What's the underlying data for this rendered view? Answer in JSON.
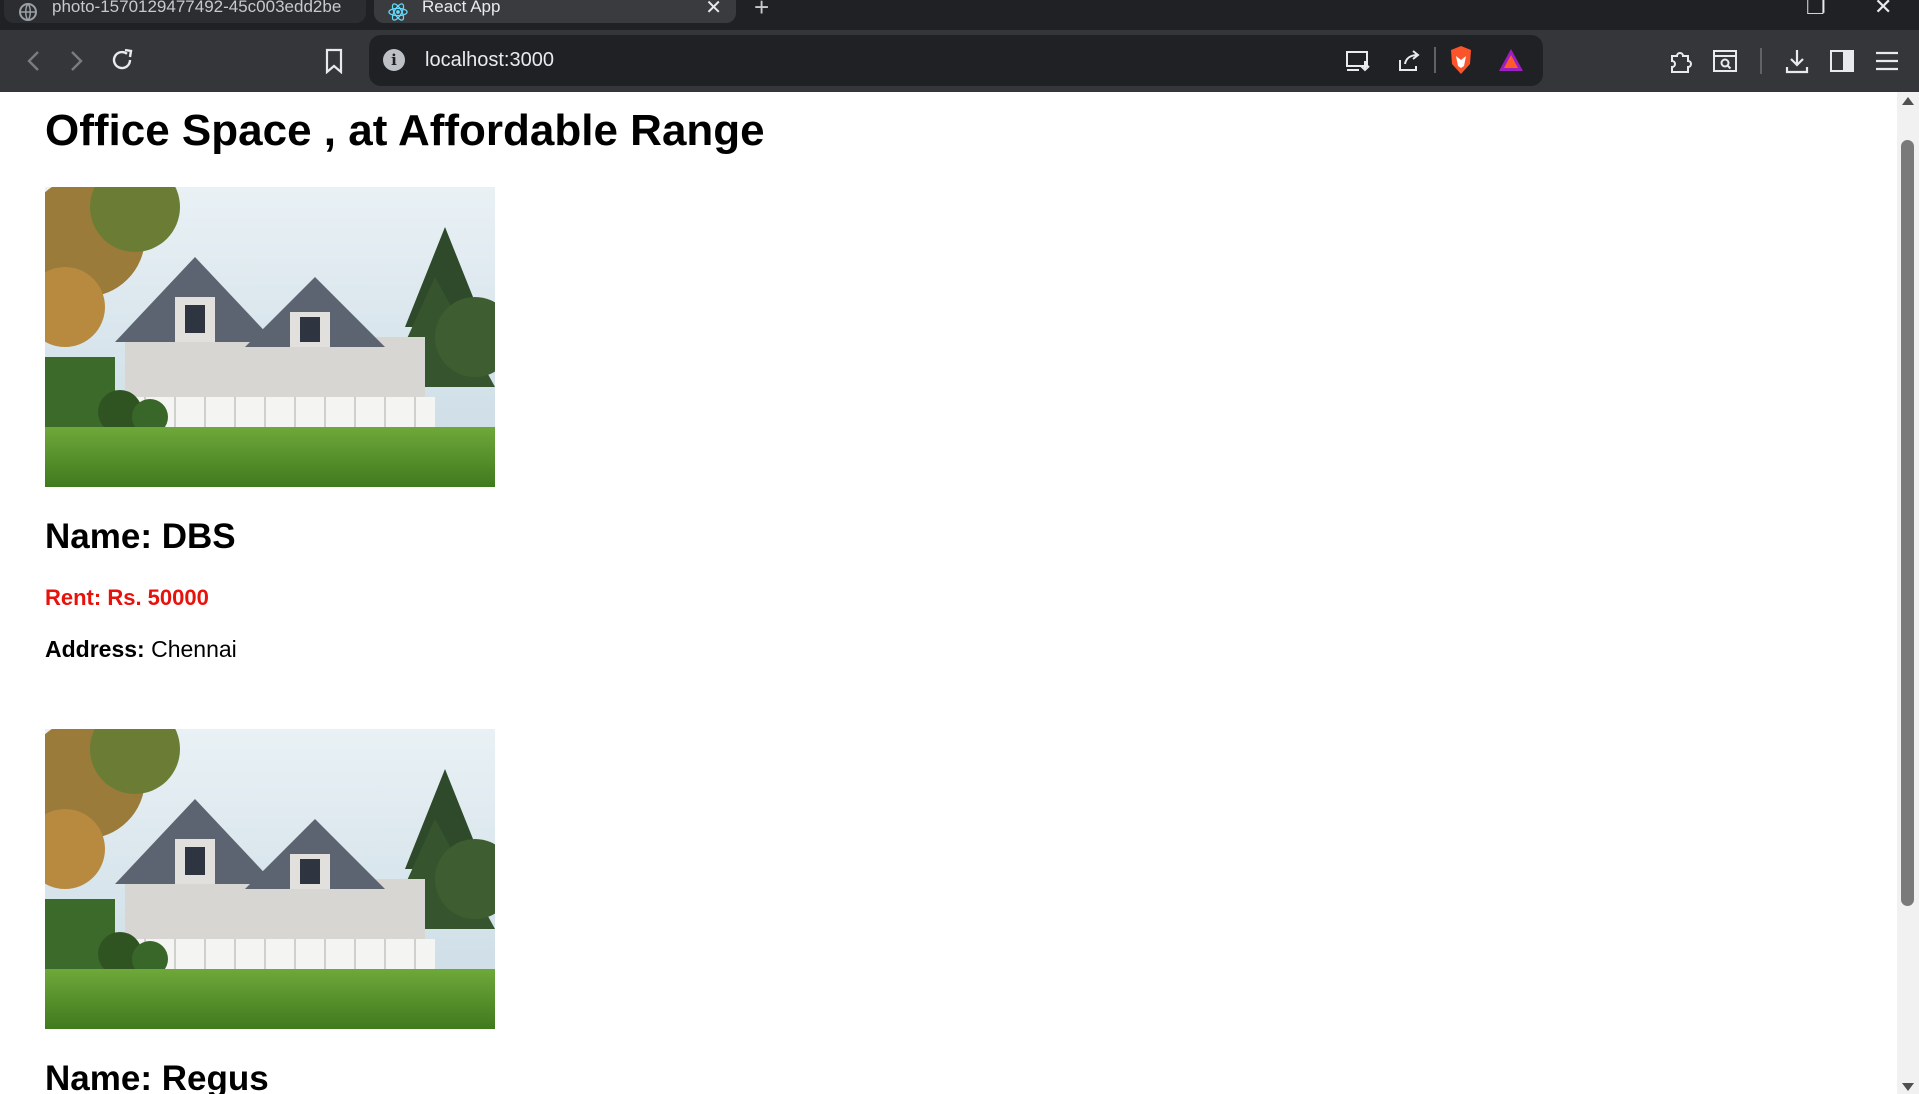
{
  "browser": {
    "tabs": [
      {
        "title": "photo-1570129477492-45c003edd2be",
        "active": false
      },
      {
        "title": "React App",
        "active": true
      }
    ],
    "url": "localhost:3000"
  },
  "page": {
    "title": "Office Space , at Affordable Range",
    "offices": [
      {
        "name_label": "Name: DBS",
        "rent_label": "Rent: Rs. 50000",
        "rent_color": "#e8120c",
        "address_label": "Address:",
        "address_value": " Chennai"
      },
      {
        "name_label": "Name: Regus"
      }
    ]
  }
}
